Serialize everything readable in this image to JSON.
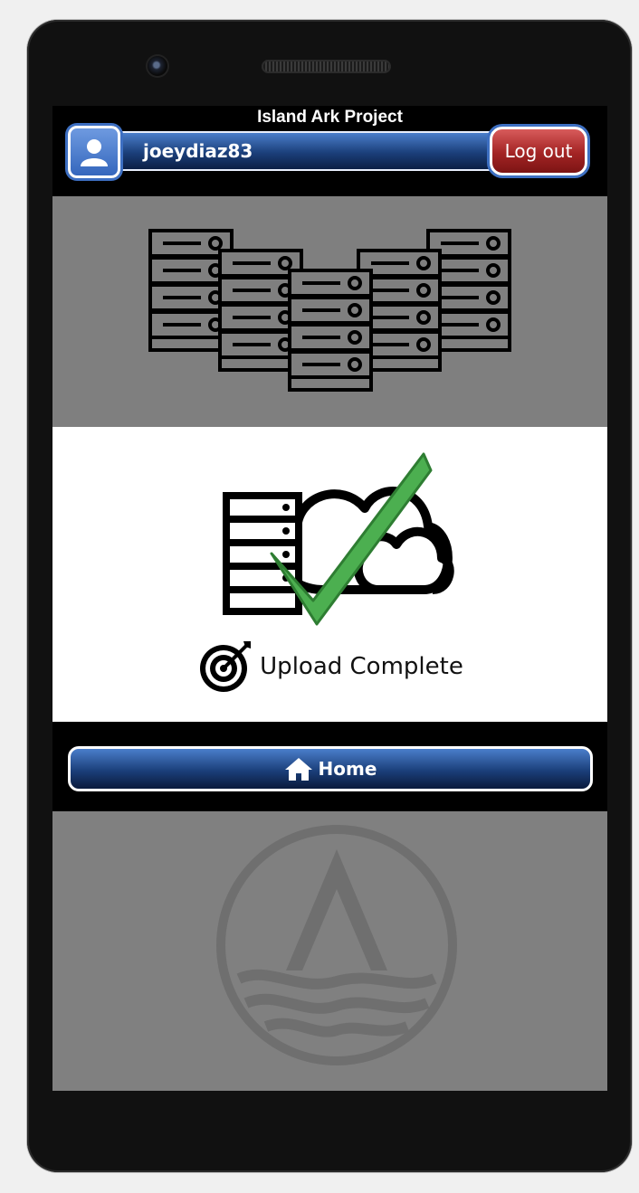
{
  "app": {
    "title": "Island Ark Project"
  },
  "header": {
    "username": "joeydiaz83",
    "logout_label": "Log out"
  },
  "upload": {
    "status_text": "Upload Complete"
  },
  "nav": {
    "home_label": "Home"
  },
  "icons": {
    "avatar": "user-icon",
    "servers": "server-rack-icon",
    "upload": "server-cloud-check-icon",
    "target": "target-icon",
    "home": "home-icon",
    "logo": "island-ark-logo-icon"
  },
  "colors": {
    "accent_blue": "#1b3f7a",
    "logout_red": "#a32424",
    "check_green": "#4caf50"
  }
}
